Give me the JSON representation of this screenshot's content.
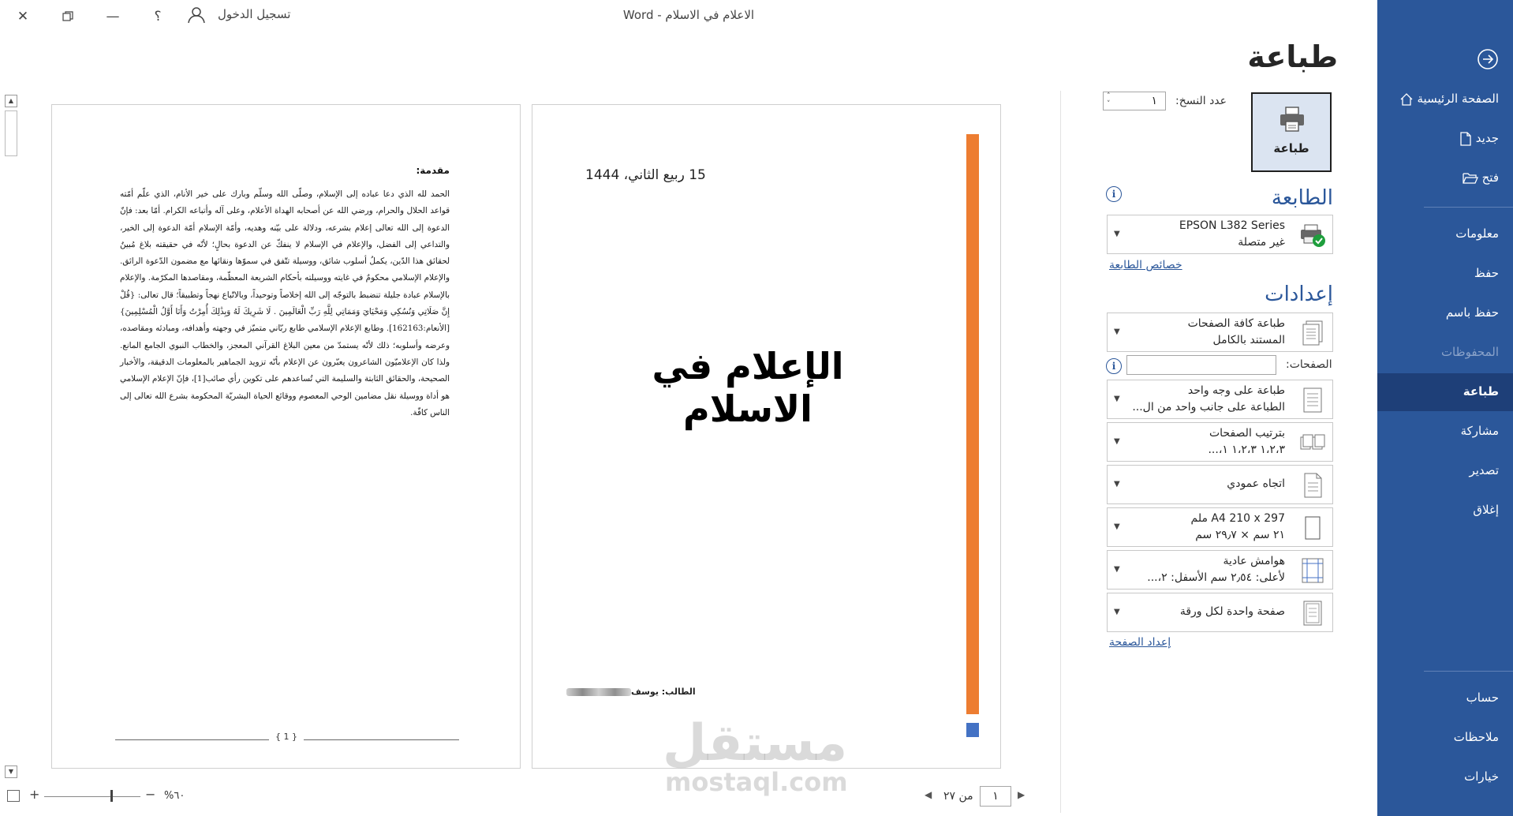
{
  "app": {
    "window_title": "الاعلام في الاسلام  -  Word",
    "sign_in": "تسجيل الدخول",
    "help": "؟"
  },
  "nav": {
    "items": [
      {
        "label": "الصفحة الرئيسية",
        "icon": "home-icon"
      },
      {
        "label": "جديد",
        "icon": "new-document-icon"
      },
      {
        "label": "فتح",
        "icon": "open-folder-icon"
      },
      {
        "label": "معلومات"
      },
      {
        "label": "حفظ"
      },
      {
        "label": "حفظ باسم"
      },
      {
        "label": "المحفوظات",
        "disabled": true
      },
      {
        "label": "طباعة",
        "active": true
      },
      {
        "label": "مشاركة"
      },
      {
        "label": "تصدير"
      },
      {
        "label": "إغلاق"
      },
      {
        "label": "حساب"
      },
      {
        "label": "ملاحظات"
      },
      {
        "label": "خيارات"
      }
    ]
  },
  "print": {
    "title": "طباعة",
    "button_label": "طباعة",
    "copies_label": "عدد النسخ:",
    "copies_value": "١",
    "printer_section": "الطابعة",
    "printer_name": "EPSON L382 Series",
    "printer_status": "غير متصلة",
    "printer_properties": "خصائص الطابعة",
    "settings_section": "إعدادات",
    "pages_label": "الصفحات:",
    "pages_value": "",
    "page_setup": "إعداد الصفحة",
    "dropdowns": [
      {
        "line1": "طباعة كافة الصفحات",
        "line2": "المستند بالكامل"
      },
      {
        "line1": "طباعة على وجه واحد",
        "line2": "الطباعة على جانب واحد من ال..."
      },
      {
        "line1": "بترتيب الصفحات",
        "line2": "١،٢،٣     ١،٢،٣     ١،..."
      },
      {
        "line1": "اتجاه عمودي"
      },
      {
        "line1": "A4 210 x 297 ملم",
        "line2": "٢١ سم × ٢٩٫٧ سم"
      },
      {
        "line1": "هوامش عادية",
        "line2": "لأعلى: ٢٫٥٤ سم الأسفل: ٢،..."
      },
      {
        "line1": "صفحة واحدة لكل ورقة"
      }
    ]
  },
  "preview": {
    "page1": {
      "date": "15 ربيع الثاني، 1444",
      "title": "الإعلام في الاسلام",
      "student": "الطالب: يوسف"
    },
    "page2": {
      "heading": "مقدمة:",
      "body": "الحمد لله الذي دعا عباده إلى الإسلام، وصلّى الله وسلّم وبارك على خير الأنام، الذي علّم أمّته قواعد الحلال والحرام، ورضي الله عن أصحابه الهداة الأعلام، وعلى آله وأتباعه الكرام. أمّا بعد: فإنّ الدعوة إلى الله تعالى إعلام بشرعه، ودلالة على بيّنه وهديه، وأمّة الإسلام أمّة الدعوة إلى الخير، والتداعي إلى الفضل، والإعلام في الإسلام لا ينفكّ عن الدعوة بحالٍ؛ لأنّه في حقيقته بلاغ مُبينٌ لحقائق هذا الدّين، يكملُ أسلوب شائق، ووسيلة تتّفق في سموّها ونقائها مع مضمون الدّعوة الرائق. والإعلام الإسلامي محكومٌ في غايته ووسيلته بأحكام الشريعة المعظّمة، ومقاصدها المكرّمة. والإعلام بالإسلام عبادة جليلة تنضبط بالتوجّه إلى الله إخلاصاً وتوحيداً، وبالاتّباع نهجاً وتطبيقاً؛ قال تعالى: {قُلْ إِنَّ صَلَاتِي وَنُسُكِي وَمَحْيَايَ وَمَمَاتِي لِلَّهِ رَبِّ الْعَالَمِينَ . لَا شَرِيكَ لَهُ وَبِذَٰلِكَ أُمِرْتُ وَأَنَا أَوَّلُ الْمُسْلِمِينَ} [الأنعام:162163]. وطابع الإعلام الإسلامي طابع ربّاني متميّز في وجهته وأهدافه، ومبادئه ومقاصده، وعرضه وأسلوبه؛ ذلك لأنّه يستمدّ من معين البلاغ القرآني المعجز، والخطاب النبوي الجامع المانع. ولذا كان الإعلاميّون الشاعرون يعبّرون عن الإعلام بأنّه تزويد الجماهير بالمعلومات الدقيقة، والأخبار الصحيحة، والحقائق الثابتة والسليمة التي تُساعدهم على تكوين رأي صائب[1]، فإنّ الإعلام الإسلامي هو أداة ووسيلة نقل مضامين الوحي المعصوم ووقائع الحياة البشريّة المحكومة بشرع الله تعالى إلى الناس كافّة.",
      "page_number": "1"
    }
  },
  "status": {
    "page_current": "١",
    "page_of": "من ٢٧",
    "zoom": "٦٠%"
  },
  "watermark": {
    "main": "مستقل",
    "sub": "mostaql.com"
  },
  "colors": {
    "nav_bg": "#2b579a",
    "nav_active": "#1e3f78",
    "accent": "#2b579a",
    "orange_bar": "#ed7d31",
    "blue_square": "#4472c4"
  }
}
